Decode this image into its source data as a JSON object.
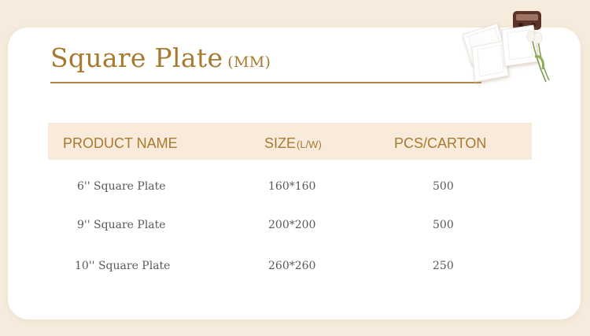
{
  "page": {
    "title": "Square Plate",
    "title_unit": "(MM)"
  },
  "table": {
    "headers": {
      "product": "PRODUCT NAME",
      "size": "SIZE",
      "size_sub": "(L/W)",
      "pcs": "PCS/CARTON"
    },
    "rows": [
      {
        "name": "6'' Square Plate",
        "size": "160*160",
        "pcs": "500"
      },
      {
        "name": "9'' Square Plate",
        "size": "200*200",
        "pcs": "500"
      },
      {
        "name": "10'' Square Plate",
        "size": "260*260",
        "pcs": "250"
      }
    ]
  },
  "colors": {
    "accent": "#a87a2f",
    "header_bg": "#f8ebdb",
    "page_bg": "#f6ebdc",
    "text": "#5a5a5a"
  }
}
